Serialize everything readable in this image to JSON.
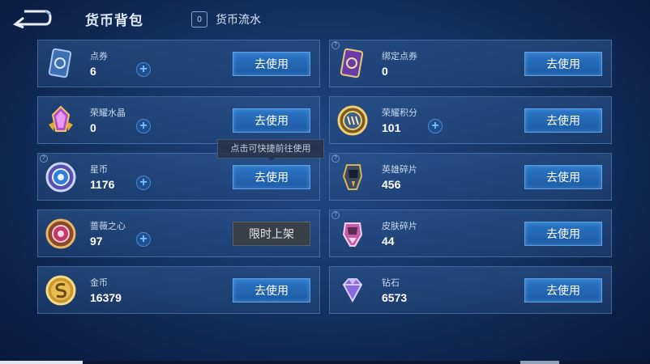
{
  "header": {
    "title": "货币背包",
    "flow_icon_text": "0",
    "flow_label": "货币流水",
    "back_icon": "back-arrow-icon"
  },
  "use_label": "去使用",
  "limited_label": "限时上架",
  "tooltip": "点击可快捷前往使用",
  "currencies": [
    {
      "name": "点券",
      "count": "6",
      "icon": "voucher-card-icon"
    },
    {
      "name": "绑定点券",
      "count": "0",
      "icon": "bound-voucher-card-icon"
    },
    {
      "name": "荣耀水晶",
      "count": "0",
      "icon": "glory-crystal-icon"
    },
    {
      "name": "荣耀积分",
      "count": "101",
      "icon": "glory-points-icon"
    },
    {
      "name": "星币",
      "count": "1176",
      "icon": "star-coin-icon"
    },
    {
      "name": "英雄碎片",
      "count": "456",
      "icon": "hero-fragment-icon"
    },
    {
      "name": "蔷薇之心",
      "count": "97",
      "icon": "rose-heart-icon"
    },
    {
      "name": "皮肤碎片",
      "count": "44",
      "icon": "skin-fragment-icon"
    },
    {
      "name": "金币",
      "count": "16379",
      "icon": "gold-coin-icon"
    },
    {
      "name": "钻石",
      "count": "6573",
      "icon": "diamond-icon"
    }
  ],
  "colors": {
    "background": "#153566",
    "button": "#1d5aa3",
    "limited_button": "#3a4048"
  }
}
